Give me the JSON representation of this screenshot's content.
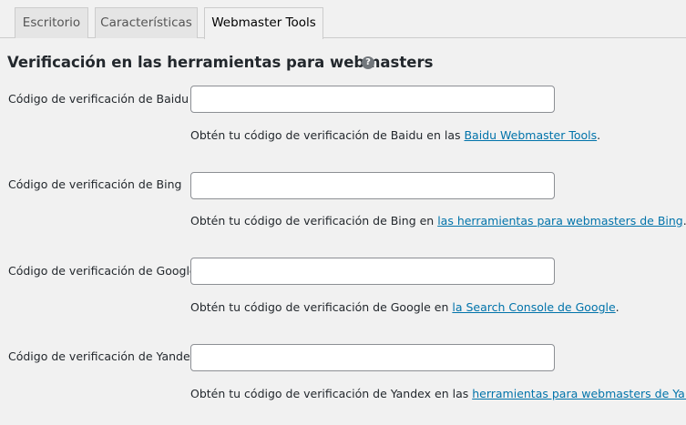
{
  "tabs": [
    {
      "label": "Escritorio",
      "active": false
    },
    {
      "label": "Características",
      "active": false
    },
    {
      "label": "Webmaster Tools",
      "active": true
    }
  ],
  "section": {
    "title": "Verificación en las herramientas para webmasters",
    "help_icon": "question-mark-icon",
    "help_glyph": "?"
  },
  "fields": [
    {
      "label": "Código de verificación de Baidu",
      "value": "",
      "desc_prefix": "Obtén tu código de verificación de Baidu en las ",
      "link_text": "Baidu Webmaster Tools",
      "desc_suffix": "."
    },
    {
      "label": "Código de verificación de Bing",
      "value": "",
      "desc_prefix": "Obtén tu código de verificación de Bing en ",
      "link_text": "las herramientas para webmasters de Bing",
      "desc_suffix": "."
    },
    {
      "label": "Código de verificación de Google",
      "value": "",
      "desc_prefix": "Obtén tu código de verificación de Google en ",
      "link_text": "la Search Console de Google",
      "desc_suffix": "."
    },
    {
      "label": "Código de verificación de Yandex",
      "value": "",
      "desc_prefix": "Obtén tu código de verificación de Yandex en las ",
      "link_text": "herramientas para webmasters de Yandex",
      "desc_suffix": "."
    }
  ],
  "colors": {
    "background": "#f1f1f1",
    "link": "#0073aa",
    "text": "#23282d"
  }
}
